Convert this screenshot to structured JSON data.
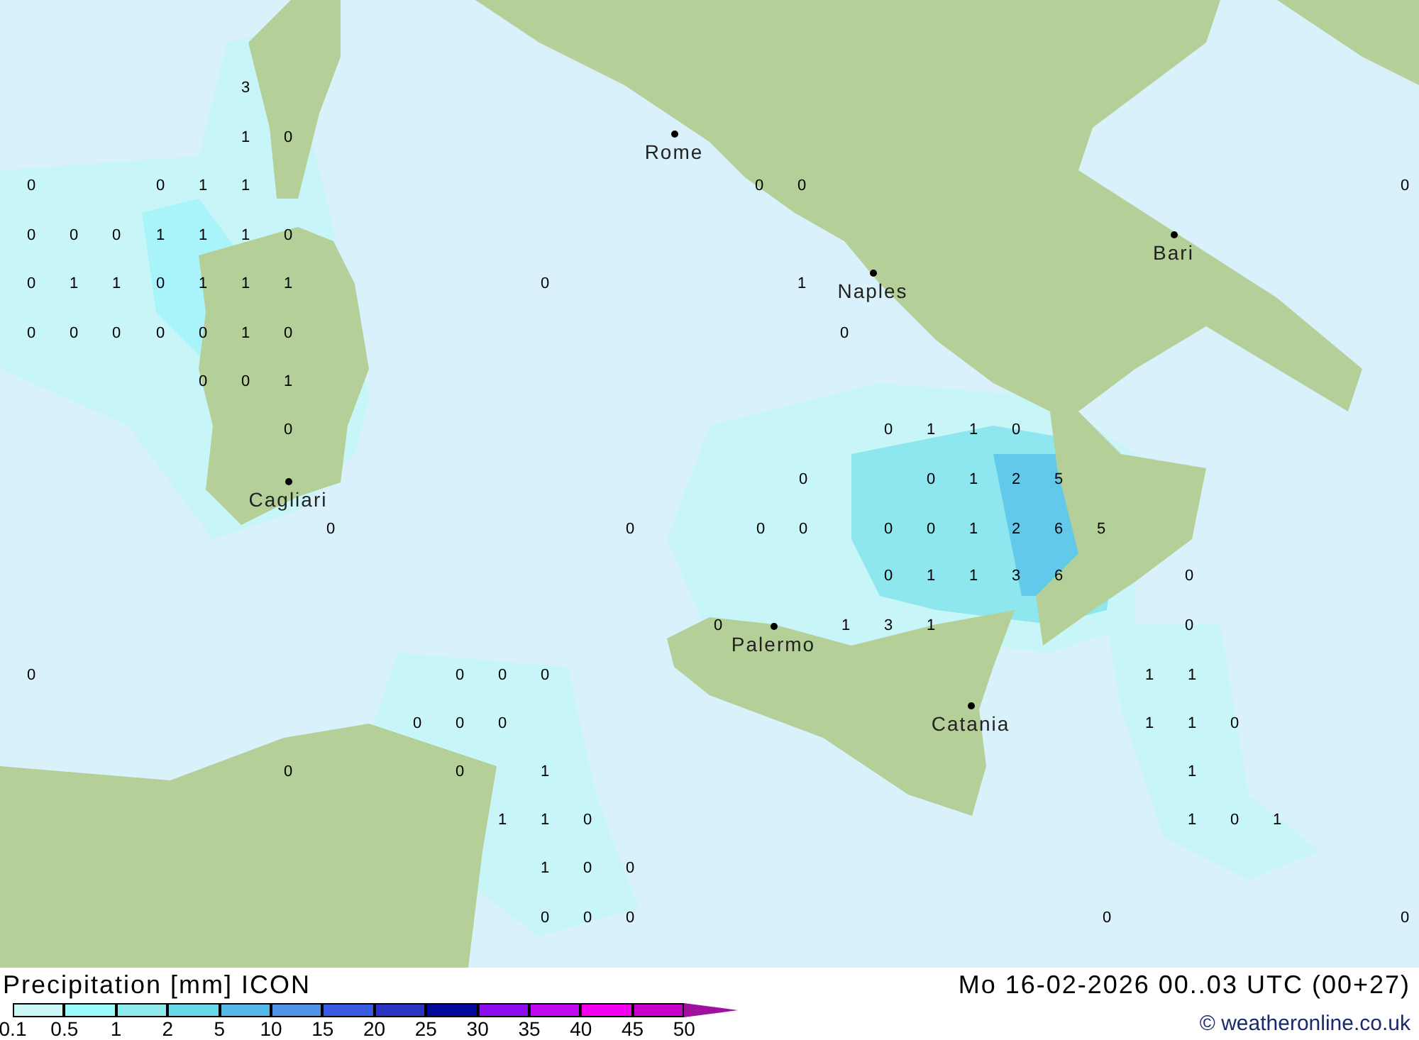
{
  "map": {
    "cities": [
      "Rome",
      "Naples",
      "Bari",
      "Cagliari",
      "Palermo",
      "Catania"
    ],
    "values": [
      "3",
      "1",
      "0",
      "0",
      "0",
      "1",
      "1",
      "0",
      "0",
      "0",
      "0",
      "0",
      "0",
      "1",
      "1",
      "1",
      "0",
      "0",
      "1",
      "1",
      "0",
      "1",
      "1",
      "1",
      "0",
      "1",
      "0",
      "0",
      "0",
      "0",
      "0",
      "1",
      "0",
      "0",
      "0",
      "0",
      "1",
      "0",
      "0",
      "1",
      "1",
      "0",
      "0",
      "0",
      "1",
      "2",
      "5",
      "0",
      "0",
      "0",
      "0",
      "0",
      "0",
      "1",
      "2",
      "6",
      "5",
      "0",
      "1",
      "1",
      "3",
      "6",
      "0",
      "0",
      "1",
      "3",
      "1",
      "0",
      "0",
      "0",
      "0",
      "0",
      "1",
      "1",
      "0",
      "0",
      "0",
      "1",
      "1",
      "0",
      "0",
      "0",
      "1",
      "1",
      "1",
      "1",
      "0",
      "1",
      "0",
      "1",
      "1",
      "0",
      "0",
      "0",
      "0",
      "0",
      "0",
      "0"
    ]
  },
  "legend": {
    "title": "Precipitation [mm] ICON",
    "steps": [
      {
        "label": "0.1",
        "color": "#cdf7f7"
      },
      {
        "label": "0.5",
        "color": "#9bfafb"
      },
      {
        "label": "1",
        "color": "#8deaea"
      },
      {
        "label": "2",
        "color": "#66d9ea"
      },
      {
        "label": "5",
        "color": "#55b7e6"
      },
      {
        "label": "10",
        "color": "#4d94e4"
      },
      {
        "label": "15",
        "color": "#3c5be5"
      },
      {
        "label": "20",
        "color": "#2a35c0"
      },
      {
        "label": "25",
        "color": "#05089c"
      },
      {
        "label": "30",
        "color": "#8c0ef0"
      },
      {
        "label": "35",
        "color": "#c008ef"
      },
      {
        "label": "40",
        "color": "#f400f0"
      },
      {
        "label": "45",
        "color": "#c800c8"
      }
    ],
    "max_label": "50"
  },
  "valid_time": "Mo 16-02-2026 00..03 UTC (00+27)",
  "credit": "© weatheronline.co.uk"
}
